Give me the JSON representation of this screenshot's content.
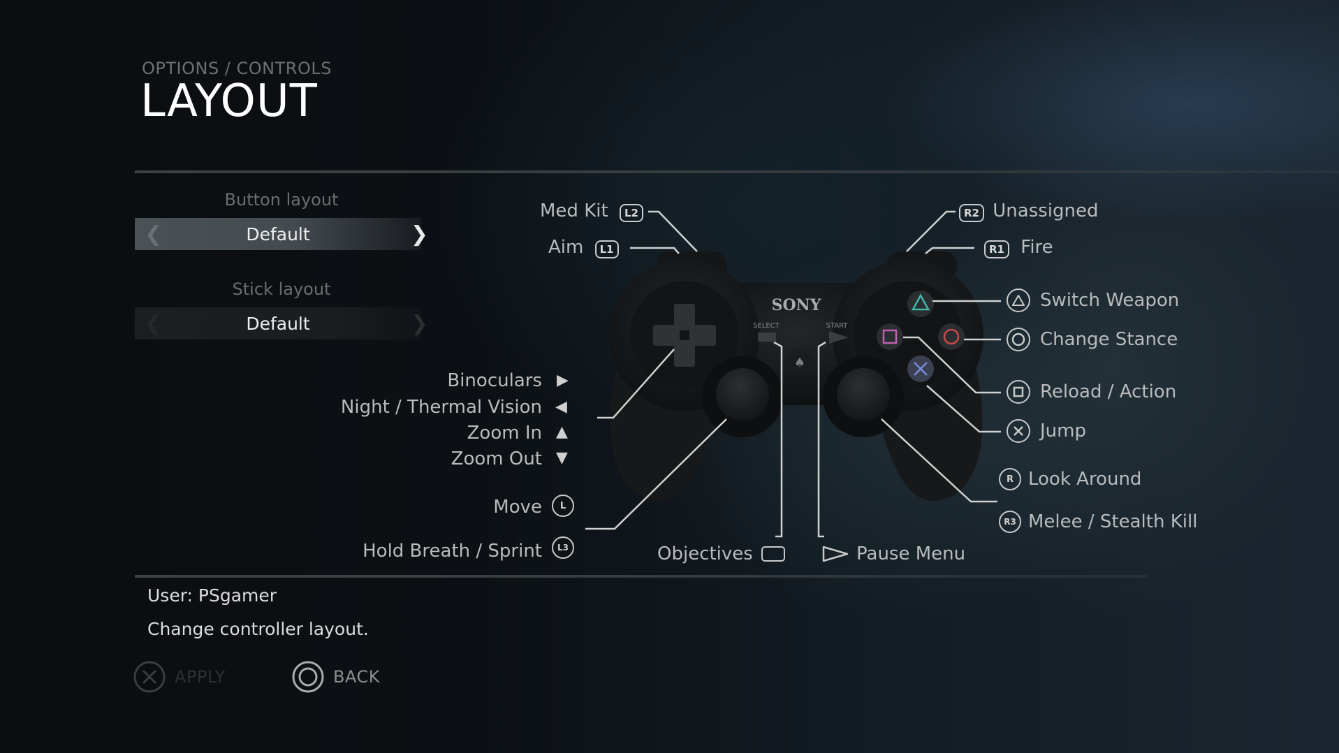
{
  "header": {
    "breadcrumb": "OPTIONS / CONTROLS",
    "title": "LAYOUT"
  },
  "options": {
    "button_layout": {
      "label": "Button layout",
      "value": "Default",
      "active": true
    },
    "stick_layout": {
      "label": "Stick layout",
      "value": "Default",
      "active": false
    }
  },
  "controller": {
    "brand": "SONY",
    "select_label": "SELECT",
    "start_label": "START",
    "face_button_colors": {
      "triangle": "#3fb8a8",
      "circle": "#c84a4a",
      "square": "#c060b0",
      "cross": "#7a8ad8"
    }
  },
  "mappings": {
    "l2": {
      "label": "Med Kit",
      "button": "L2"
    },
    "l1": {
      "label": "Aim",
      "button": "L1"
    },
    "r2": {
      "label": "Unassigned",
      "button": "R2"
    },
    "r1": {
      "label": "Fire",
      "button": "R1"
    },
    "triangle": {
      "label": "Switch Weapon",
      "icon": "triangle-button-icon"
    },
    "circle": {
      "label": "Change Stance",
      "icon": "circle-button-icon"
    },
    "square": {
      "label": "Reload / Action",
      "icon": "square-button-icon"
    },
    "cross": {
      "label": "Jump",
      "icon": "cross-button-icon"
    },
    "right_stick": {
      "label": "Look Around",
      "button": "R"
    },
    "r3": {
      "label": "Melee / Stealth Kill",
      "button": "R3"
    },
    "dpad_right": {
      "label": "Binoculars",
      "glyph": "▶"
    },
    "dpad_left": {
      "label": "Night / Thermal Vision",
      "glyph": "◀"
    },
    "dpad_up": {
      "label": "Zoom In",
      "glyph": "▲"
    },
    "dpad_down": {
      "label": "Zoom Out",
      "glyph": "▼"
    },
    "left_stick": {
      "label": "Move",
      "button": "L"
    },
    "l3": {
      "label": "Hold Breath / Sprint",
      "button": "L3"
    },
    "select": {
      "label": "Objectives"
    },
    "start": {
      "label": "Pause Menu"
    }
  },
  "footer": {
    "user": "User: PSgamer",
    "hint": "Change controller layout.",
    "apply_label": "APPLY",
    "back_label": "BACK",
    "apply_enabled": false
  }
}
